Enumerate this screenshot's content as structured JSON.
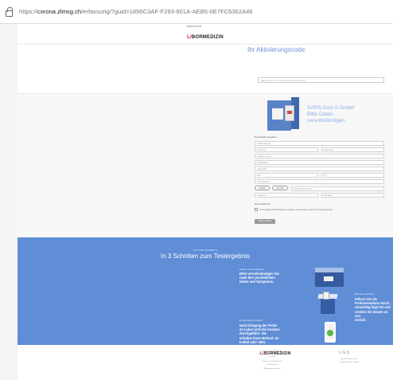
{
  "browser": {
    "url_scheme": "https://",
    "url_host": "corona.zlmsg.ch",
    "url_path": "/erfassung/?guid=1856C3AF-F283-801A-AEB5-0E7FC6362A46"
  },
  "header": {
    "logo_pre": "ZENTRUM FÜR",
    "logo_red": "L/",
    "logo_main": "BORMEDIZIN"
  },
  "activation": {
    "title": "Ihr Aktivierungscode:",
    "placeholder": "Bitte geben Sie Ihren Aktivierungscode ein"
  },
  "intro": {
    "line1": "SARS-CoV-2-Testkit",
    "line2": "Bitte Daten",
    "line3": "vervollständigen"
  },
  "form": {
    "section_label": "Persönliche Angaben",
    "f_email": "E-Mail-Adresse",
    "f_firstname": "Vorname",
    "f_lastname": "Nachname",
    "f_country": "Schweiz (+41) ▾",
    "f_phone": "Mobiltelefon",
    "f_street": "Strasse/Nr.",
    "f_zip": "PLZ",
    "f_city": "Ort",
    "f_birth": "Geburtsdatum",
    "btn_female": "weiblich",
    "btn_male": "männlich",
    "f_ahv": "Versichertennummer",
    "f_symptoms": "Symptome",
    "f_date": "Testdatum",
    "consent_label": "Einverständnis",
    "consent_text": "Ich bestätige die Richtigkeit der Angaben und akzeptiere die Nutzungsbedingungen.",
    "submit": "Daten senden"
  },
  "steps": {
    "pre": "SO FUNKTIONIERT'S",
    "title": "In 3 Schritten zum Testergebnis",
    "s1_label": "■ Daten vervollständigen",
    "s1_text": [
      "Bitte vervollständigen Sie",
      "nach Ihre persönlichen",
      "Daten und Symptome."
    ],
    "s2_label": "■ Probe entnehmen",
    "s2_text": [
      "Führen Sie die",
      "Probeentnahme durch.",
      "Umschlag liegt bei und",
      "senden Sie diesen an uns",
      "zurück."
    ],
    "s3_label": "■ Testergebnis erhalten",
    "s3_text": [
      "Nach Eingang der Probe",
      "im Labor wird die Analyse",
      "durchgeführt. Sie",
      "erhalten Ihren Befund via",
      "E-Mail oder SMS."
    ]
  },
  "footer": {
    "logo_red": "L/",
    "logo_main": "BORMEDIZIN",
    "left_lines": [
      "Zentrum für Labormedizin",
      "Frohbergstrasse 3, 9001 St. Gallen",
      "Schweiz"
    ],
    "left_lines2": [
      "Telefon +41 71 494 39 00",
      "info@zlmsg.ch"
    ],
    "left_lines3": [
      "Öffnungszeiten Labor"
    ],
    "right_brand": "LGS",
    "right_lines": [
      "Ein Unternehmen von",
      "Labormedizin St. Gallen"
    ]
  },
  "colors": {
    "accent": "#6d8fd6",
    "steps_bg": "#5f8dd6",
    "brand_red": "#c8202e"
  }
}
